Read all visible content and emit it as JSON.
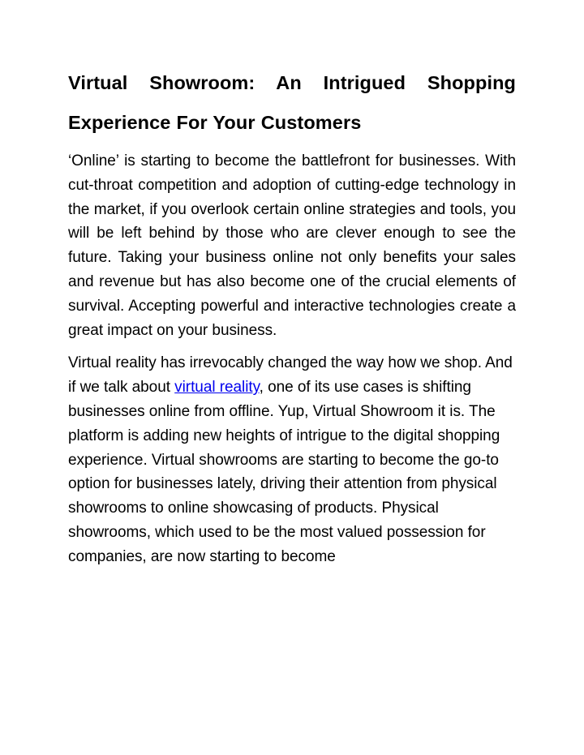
{
  "document": {
    "title": "Virtual Showroom: An Intrigued Shopping Experience For Your Customers",
    "background_color": "#ffffff",
    "text_color": "#000000",
    "link_color": "#0000ee",
    "paragraphs": [
      {
        "id": "paragraph-1",
        "alignment": "justified",
        "text": "‘Online’ is starting to become the battlefront for businesses. With cut-throat competition and adoption of cutting-edge technology in the market, if you overlook certain online strategies and tools, you will be left behind by those who are clever enough to see the future. Taking your business online not only benefits your sales and revenue but has also become one of the crucial elements of survival. Accepting powerful and interactive technologies create a great impact on your business."
      },
      {
        "id": "paragraph-2",
        "alignment": "left",
        "segments": {
          "before_link": "Virtual reality has irrevocably changed the way how we shop. And if we talk about ",
          "link_text": "virtual reality",
          "after_link": ", one of its use cases is shifting businesses online from offline. Yup, Virtual Showroom it is. The platform is adding new heights of intrigue to the digital shopping experience. Virtual showrooms are starting to become the go-to option for businesses lately, driving their attention from physical showrooms to online showcasing of products.  Physical showrooms, which used to be the most valued possession for companies, are now starting to become"
        }
      }
    ]
  }
}
